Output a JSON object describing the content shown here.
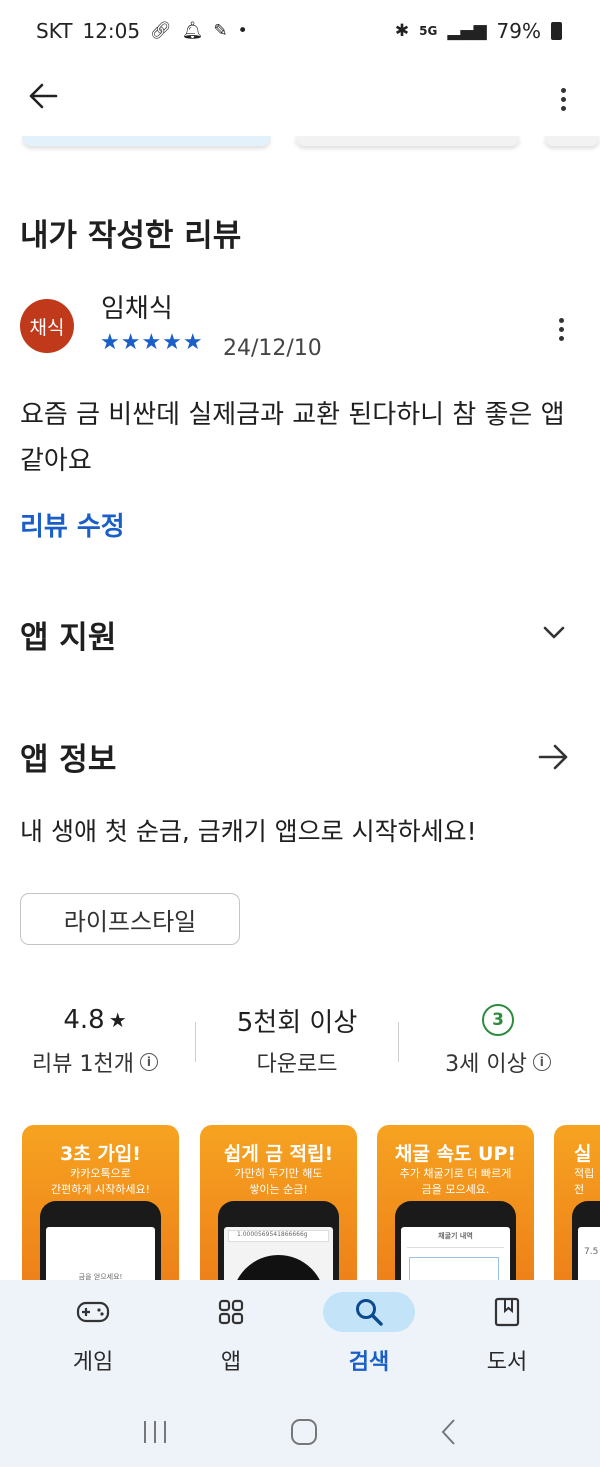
{
  "status_bar": {
    "carrier": "SKT",
    "time": "12:05",
    "network": "5G",
    "battery": "79%"
  },
  "review_section": {
    "title": "내가 작성한 리뷰",
    "avatar_text": "채식",
    "reviewer_name": "임채식",
    "stars": "★★★★★",
    "rating": 5,
    "date": "24/12/10",
    "text": "요즘 금 비싼데 실제금과 교환 된다하니 참 좋은 앱 같아요",
    "edit_label": "리뷰 수정"
  },
  "app_support": {
    "title": "앱 지원"
  },
  "app_info": {
    "title": "앱 정보",
    "tagline": "내 생애 첫 순금, 금캐기 앱으로 시작하세요!",
    "category": "라이프스타일"
  },
  "stats": {
    "rating_value": "4.8",
    "rating_star": "★",
    "reviews_label": "리뷰 1천개",
    "downloads_value": "5천회 이상",
    "downloads_label": "다운로드",
    "age_badge": "3",
    "age_label": "3세 이상",
    "info_glyph": "i"
  },
  "screenshots": [
    {
      "headline": "3초 가입!",
      "sub1": "카카오톡으로",
      "sub2": "간편하게 시작하세요!",
      "screen_text": "금을 얻으세요!"
    },
    {
      "headline": "쉽게 금 적립!",
      "sub1": "가만히 두기만 해도",
      "sub2": "쌓이는 순금!",
      "screen_text": "1.0000569541866666g"
    },
    {
      "headline": "채굴 속도 UP!",
      "sub1": "추가 채굴기로 더 빠르게",
      "sub2": "금을 모으세요.",
      "screen_text": "채굴기 내역"
    },
    {
      "headline": "실",
      "sub1": "적립",
      "sub2": "전",
      "screen_text": "7.5"
    }
  ],
  "bottom_nav": [
    {
      "label": "게임",
      "icon": "gamepad-icon"
    },
    {
      "label": "앱",
      "icon": "apps-grid-icon"
    },
    {
      "label": "검색",
      "icon": "search-icon",
      "active": true
    },
    {
      "label": "도서",
      "icon": "book-icon"
    }
  ],
  "colors": {
    "accent_blue": "#1a5fc8",
    "avatar_red": "#c0391a",
    "age_green": "#2e8b3e",
    "nav_bg": "#eef3fa",
    "nav_active": "#c3e3f9",
    "promo_orange": "#f6a321"
  }
}
